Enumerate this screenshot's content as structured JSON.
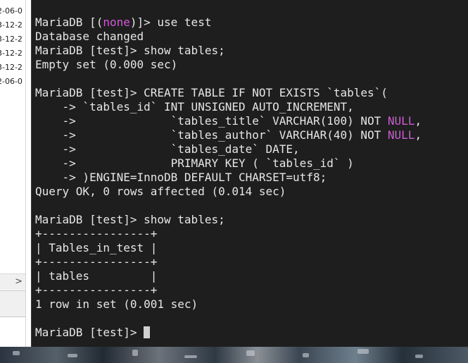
{
  "background_window": {
    "dates": [
      "2-06-0",
      "3-12-2",
      "3-12-2",
      "3-12-2",
      "3-12-2",
      "2-06-0"
    ],
    "scroll_arrow": ">"
  },
  "terminal": {
    "lines": [
      [
        {
          "t": "MariaDB [("
        },
        {
          "t": "none",
          "hl": true
        },
        {
          "t": ")]> use test"
        }
      ],
      [
        {
          "t": "Database changed"
        }
      ],
      [
        {
          "t": "MariaDB [test]> show tables;"
        }
      ],
      [
        {
          "t": "Empty set (0.000 sec)"
        }
      ],
      [
        {
          "t": ""
        }
      ],
      [
        {
          "t": "MariaDB [test]> CREATE TABLE IF NOT EXISTS `tables`("
        }
      ],
      [
        {
          "t": "    -> `tables_id` INT UNSIGNED AUTO_INCREMENT,"
        }
      ],
      [
        {
          "t": "    ->              `tables_title` VARCHAR(100) NOT "
        },
        {
          "t": "NULL",
          "hl": true
        },
        {
          "t": ","
        }
      ],
      [
        {
          "t": "    ->              `tables_author` VARCHAR(40) NOT "
        },
        {
          "t": "NULL",
          "hl": true
        },
        {
          "t": ","
        }
      ],
      [
        {
          "t": "    ->              `tables_date` DATE,"
        }
      ],
      [
        {
          "t": "    ->              PRIMARY KEY ( `tables_id` )"
        }
      ],
      [
        {
          "t": "    -> )ENGINE=InnoDB DEFAULT CHARSET=utf8;"
        }
      ],
      [
        {
          "t": "Query OK, 0 rows affected (0.014 sec)"
        }
      ],
      [
        {
          "t": ""
        }
      ],
      [
        {
          "t": "MariaDB [test]> show tables;"
        }
      ],
      [
        {
          "t": "+----------------+"
        }
      ],
      [
        {
          "t": "| Tables_in_test |"
        }
      ],
      [
        {
          "t": "+----------------+"
        }
      ],
      [
        {
          "t": "| tables         |"
        }
      ],
      [
        {
          "t": "+----------------+"
        }
      ],
      [
        {
          "t": "1 row in set (0.001 sec)"
        }
      ],
      [
        {
          "t": ""
        }
      ],
      [
        {
          "t": "MariaDB [test]> "
        }
      ]
    ],
    "colors": {
      "background": "#1e1e1e",
      "text": "#e6e6e6",
      "highlight": "#d15ad7",
      "cursor": "#d0d0d0"
    }
  }
}
